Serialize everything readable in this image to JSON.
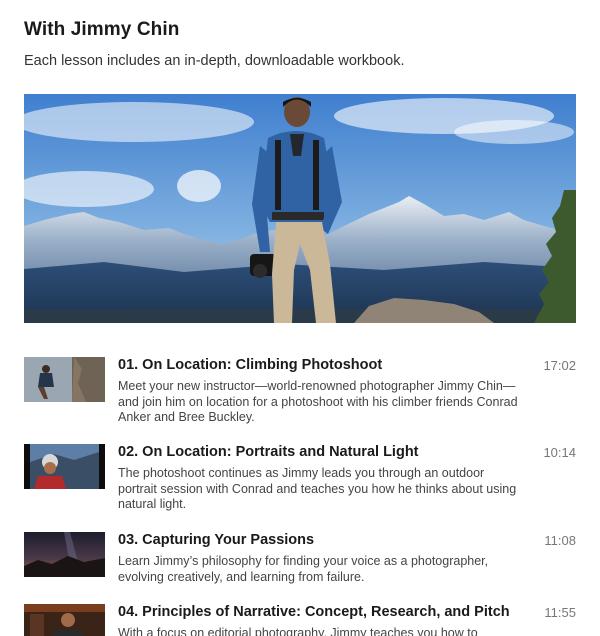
{
  "header": {
    "title": "With Jimmy Chin",
    "subtitle": "Each lesson includes an in-depth, downloadable workbook."
  },
  "lessons": [
    {
      "title": "01. On Location: Climbing Photoshoot",
      "description": "Meet your new instructor—world-renowned photographer Jimmy Chin—and join him on location for a photoshoot with his climber friends Conrad Anker and Bree Buckley.",
      "duration": "17:02"
    },
    {
      "title": "02. On Location: Portraits and Natural Light",
      "description": "The photoshoot continues as Jimmy leads you through an outdoor portrait session with Conrad and teaches you how he thinks about using natural light.",
      "duration": "10:14"
    },
    {
      "title": "03. Capturing Your Passions",
      "description": "Learn Jimmy’s philosophy for finding your voice as a photographer, evolving creatively, and learning from failure.",
      "duration": "11:08"
    },
    {
      "title": "04. Principles of Narrative: Concept, Research, and Pitch",
      "description": "With a focus on editorial photography, Jimmy teaches you how to",
      "duration": "11:55"
    }
  ]
}
